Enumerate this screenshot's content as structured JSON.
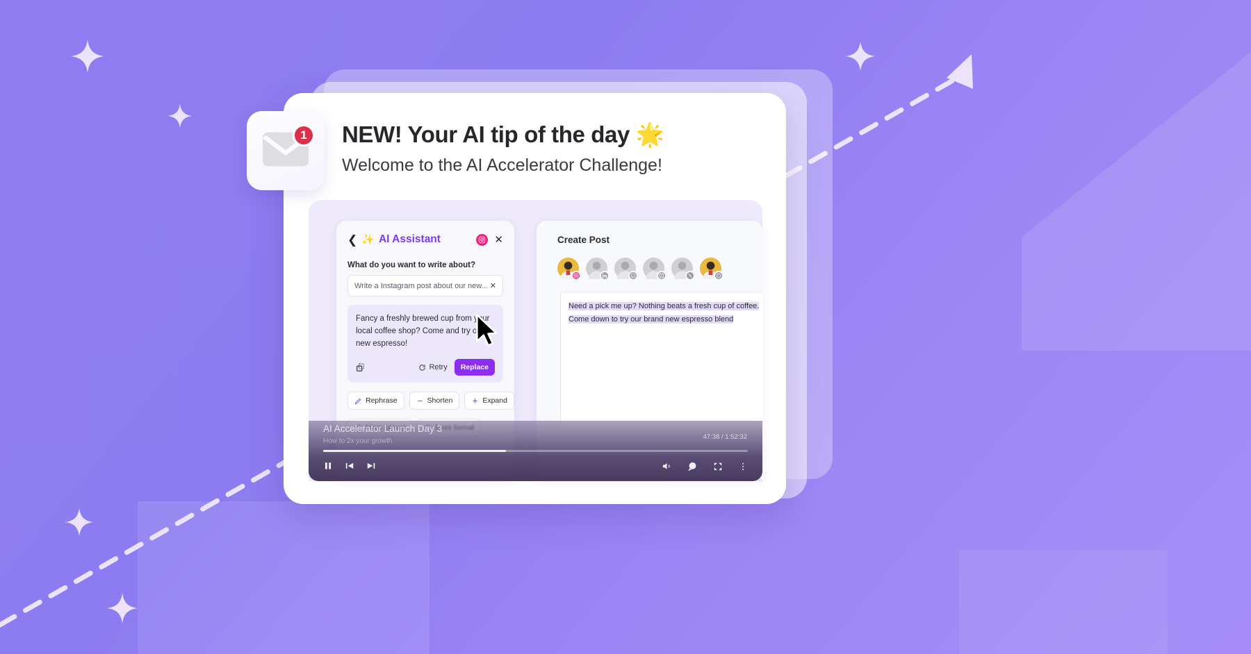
{
  "notification": {
    "badge_count": "1",
    "icon": "envelope-icon"
  },
  "header": {
    "headline": "NEW! Your AI tip of the day 🌟",
    "subhead": "Welcome to the AI Accelerator Challenge!"
  },
  "assistant": {
    "back_icon": "chevron-left-icon",
    "wand_icon": "✨",
    "title": "AI Assistant",
    "platform_icon": "instagram-icon",
    "close_icon": "close-icon",
    "field_label": "What do you want to write about?",
    "prompt_value": "Write a Instagram post about our new...",
    "prompt_placeholder": "Write a Instagram post about our new...",
    "clear_icon": "✕",
    "generated_text": "Fancy a freshly brewed cup from your local coffee shop?  Come and try our new espresso!",
    "copy_icon": "copy-icon",
    "retry_label": "Retry",
    "retry_icon": "refresh-icon",
    "replace_label": "Replace",
    "replace_color": "#8b2ef0",
    "tone_chips": [
      {
        "label": "Rephrase",
        "icon": "pen-icon"
      },
      {
        "label": "Shorten",
        "icon": "minus-icon"
      },
      {
        "label": "Expand",
        "icon": "plus-icon"
      },
      {
        "label": "More casual",
        "icon": "tshirt-icon"
      },
      {
        "label": "More formal",
        "icon": "briefcase-icon"
      }
    ]
  },
  "create_post": {
    "title": "Create Post",
    "accounts": [
      {
        "platform": "instagram",
        "active": true
      },
      {
        "platform": "linkedin",
        "active": false
      },
      {
        "platform": "pinterest",
        "active": false
      },
      {
        "platform": "facebook",
        "active": false
      },
      {
        "platform": "twitter",
        "active": false
      },
      {
        "platform": "instagram",
        "active": false
      }
    ],
    "post_text": "Need a pick me up? Nothing beats a fresh cup of coffee. Come down to try our brand new espresso blend"
  },
  "video": {
    "title": "AI Accelerator Launch Day 3",
    "subtitle": "How to 2x your growth",
    "current_time": "47:38",
    "total_time": "1:52:32",
    "time_display": "47:38 / 1:52:32",
    "progress_percent": "43",
    "controls_left": [
      "pause-icon",
      "previous-icon",
      "next-icon"
    ],
    "controls_right": [
      "volume-icon",
      "chat-icon",
      "fullscreen-icon",
      "more-icon"
    ]
  },
  "theme": {
    "background_start": "#8f7df0",
    "background_end": "#a48ef6",
    "accent_purple": "#7c3aed",
    "badge_red": "#dc2f4b",
    "instagram_pink": "#e5177f"
  }
}
